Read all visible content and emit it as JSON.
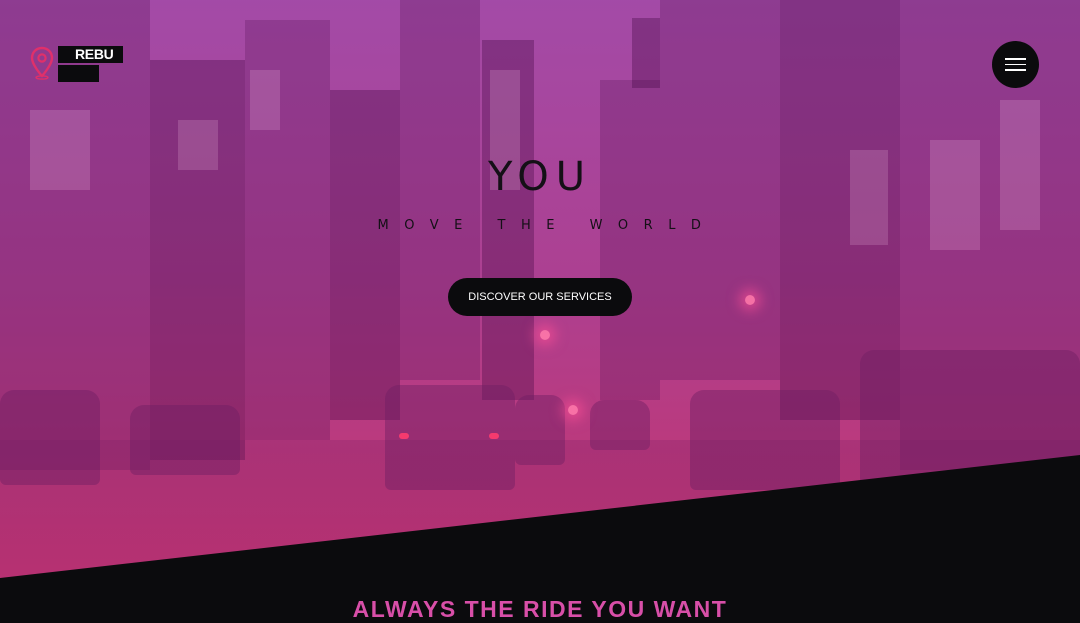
{
  "brand": {
    "name": "REBU",
    "logo_icon": "map-pin-icon",
    "accent_color": "#e0306a"
  },
  "nav": {
    "menu_icon": "hamburger-menu-icon"
  },
  "hero": {
    "title": "YOU",
    "subtitle": "MOVE THE WORLD",
    "cta_label": "DISCOVER OUR SERVICES",
    "overlay_color": "#c04aa8"
  },
  "next_section": {
    "heading": "ALWAYS THE RIDE YOU WANT",
    "heading_color": "#d84fa8"
  }
}
